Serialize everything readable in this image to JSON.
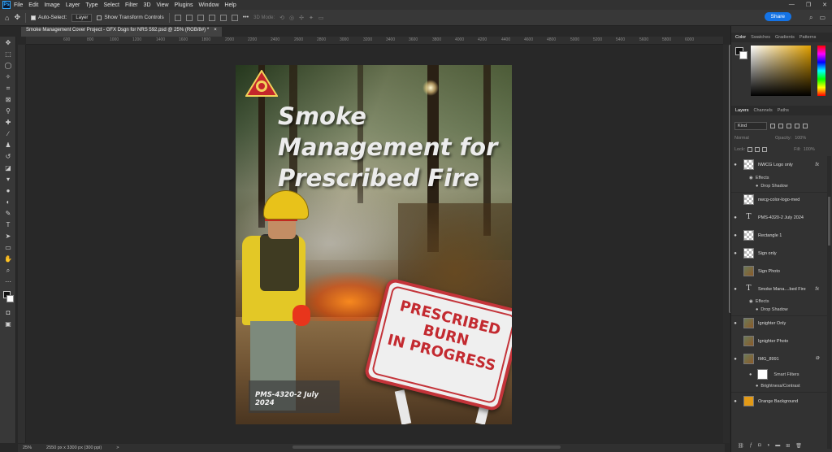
{
  "menubar": {
    "logo": "Ps",
    "items": [
      "File",
      "Edit",
      "Image",
      "Layer",
      "Type",
      "Select",
      "Filter",
      "3D",
      "View",
      "Plugins",
      "Window",
      "Help"
    ],
    "window_controls": [
      "—",
      "❐",
      "✕"
    ]
  },
  "options": {
    "auto_select_label": "Auto-Select:",
    "auto_select_value": "Layer",
    "show_transform_label": "Show Transform Controls",
    "mode_3d_label": "3D Mode:",
    "more": "•••",
    "share_label": "Share"
  },
  "document": {
    "tab_title": "Smoke Management Cover Project - GFX Dsgn for NRS 592.psd @ 25% (RGB/8#) *",
    "close": "×"
  },
  "ruler": {
    "ticks": [
      "600",
      "800",
      "1000",
      "1200",
      "1400",
      "1600",
      "1800",
      "2000",
      "2200",
      "2400",
      "2600",
      "2800",
      "3000",
      "3200",
      "3400",
      "3600",
      "3800",
      "4000",
      "4200",
      "4400",
      "4600",
      "4800",
      "5000",
      "5200",
      "5400",
      "5600",
      "5800",
      "6000"
    ]
  },
  "status": {
    "zoom": "25%",
    "doc_size": "2550 px x 3300 px (300 ppi)",
    "arrow": ">"
  },
  "poster": {
    "title_line1": "Smoke",
    "title_line2": "Management for",
    "title_line3": "Prescribed Fire",
    "pms_label": "PMS-4320-2  July 2024",
    "sign_line1": "PRESCRIBED",
    "sign_line2": "BURN",
    "sign_line3": "IN PROGRESS"
  },
  "panels": {
    "color_tabs": [
      "Color",
      "Swatches",
      "Gradients",
      "Patterns"
    ],
    "layers_tabs": [
      "Layers",
      "Channels",
      "Paths"
    ],
    "kind_label": "Kind",
    "blend_mode": "Normal",
    "opacity_label": "Opacity:",
    "opacity_value": "100%",
    "lock_label": "Lock:",
    "fill_label": "Fill:",
    "fill_value": "100%"
  },
  "layers": [
    {
      "name": "NWCG Logo only",
      "visible": true,
      "fx": "fx"
    },
    {
      "name": "Effects"
    },
    {
      "name": "Drop Shadow"
    },
    {
      "name": "nwcg-color-logo-med",
      "visible": false
    },
    {
      "name": "PMS-4320-2   July 2024",
      "visible": true
    },
    {
      "name": "Rectangle 1",
      "visible": true
    },
    {
      "name": "Sign only",
      "visible": true
    },
    {
      "name": "Sign Photo",
      "visible": false
    },
    {
      "name": "Smoke Mana....bed Fire",
      "visible": true,
      "fx": "fx"
    },
    {
      "name": "Effects"
    },
    {
      "name": "Drop Shadow"
    },
    {
      "name": "Ignighter Only",
      "visible": true
    },
    {
      "name": "Ignighter Photo",
      "visible": false
    },
    {
      "name": "IMG_8991",
      "visible": true
    },
    {
      "name": "Smart Filters"
    },
    {
      "name": "Brightness/Contrast"
    },
    {
      "name": "Orange Background",
      "visible": true
    }
  ],
  "colors": {
    "orange_bg": "#e39a16",
    "sign_red": "#c4343a",
    "share_blue": "#1473e6"
  }
}
